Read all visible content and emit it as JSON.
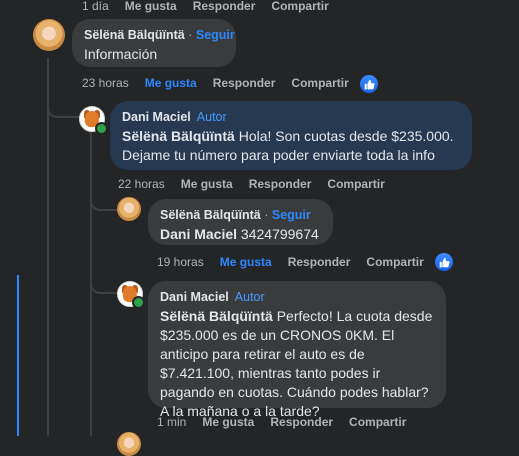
{
  "top_actions": {
    "time": "1 día",
    "like": "Me gusta",
    "reply": "Responder",
    "share": "Compartir"
  },
  "comments": [
    {
      "author": "Sëlënä Bälqüïntä",
      "dot": "·",
      "follow": "Seguir",
      "text": "Información",
      "actions": {
        "time": "23 horas",
        "like": "Me gusta",
        "reply": "Responder",
        "share": "Compartir"
      },
      "liked": true
    },
    {
      "author": "Dani Maciel",
      "badge": "Autor",
      "mention": "Sëlënä Bälqüïntä",
      "text": " Hola! Son cuotas desde $235.000. Dejame tu número para poder enviarte toda la info",
      "actions": {
        "time": "22 horas",
        "like": "Me gusta",
        "reply": "Responder",
        "share": "Compartir"
      },
      "liked": false
    },
    {
      "author": "Sëlënä Bälqüïntä",
      "dot": "·",
      "follow": "Seguir",
      "mention": "Dani Maciel",
      "text": " 3424799674",
      "actions": {
        "time": "19 horas",
        "like": "Me gusta",
        "reply": "Responder",
        "share": "Compartir"
      },
      "liked": true
    },
    {
      "author": "Dani Maciel",
      "badge": "Autor",
      "mention": "Sëlënä Bälqüïntä",
      "text": " Perfecto! La cuota desde $235.000 es de un CRONOS 0KM. El anticipo para retirar el auto es de $7.421.100, mientras tanto podes ir pagando en cuotas. Cuándo podes hablar? A la mañana o a la tarde?",
      "actions": {
        "time": "1 min",
        "like": "Me gusta",
        "reply": "Responder",
        "share": "Compartir"
      },
      "liked": false
    }
  ],
  "colors": {
    "link": "#2d88ff",
    "bubble": "#3a3b3c",
    "highlight": "#263951",
    "background": "#242526"
  },
  "icons": {
    "like_badge": "thumbs-up-icon",
    "online": "online-status-dot"
  }
}
